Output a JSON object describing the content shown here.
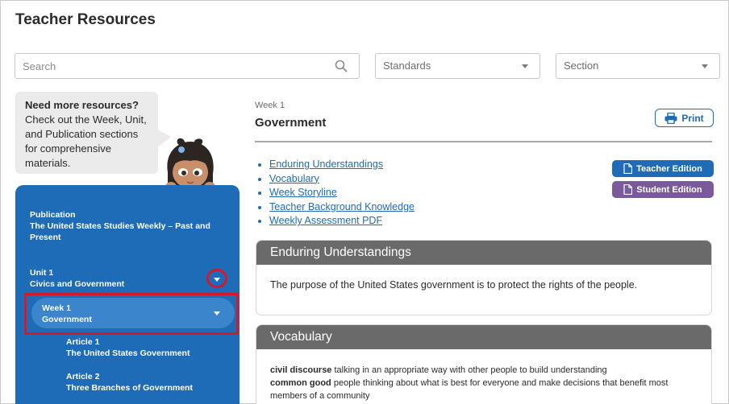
{
  "page": {
    "title": "Teacher Resources"
  },
  "filters": {
    "search_placeholder": "Search",
    "standards_label": "Standards",
    "section_label": "Section"
  },
  "bubble": {
    "bold": "Need more resources?",
    "text": "Check out the Week, Unit, and Publication sections for comprehensive materials."
  },
  "nav": {
    "publication": {
      "label": "Publication",
      "value": "The United States Studies Weekly – Past and Present"
    },
    "unit": {
      "label": "Unit 1",
      "value": "Civics and Government"
    },
    "week": {
      "label": "Week 1",
      "value": "Government"
    },
    "articles": [
      {
        "label": "Article 1",
        "value": "The United States Government"
      },
      {
        "label": "Article 2",
        "value": "Three Branches of Government"
      }
    ]
  },
  "content": {
    "week_label": "Week 1",
    "week_title": "Government",
    "print_label": "Print",
    "links": [
      "Enduring Understandings",
      "Vocabulary",
      "Week Storyline",
      "Teacher Background Knowledge",
      "Weekly Assessment PDF"
    ],
    "teacher_edition": "Teacher Edition",
    "student_edition": "Student Edition",
    "enduring": {
      "title": "Enduring Understandings",
      "text": "The purpose of the United States government is to protect the rights of the people."
    },
    "vocabulary": {
      "title": "Vocabulary",
      "terms": [
        {
          "term": "civil discourse",
          "definition": "talking in an appropriate way with other people to build understanding"
        },
        {
          "term": "common good",
          "definition": "people thinking about what is best for everyone and make decisions that benefit most members of a community"
        }
      ]
    }
  },
  "colors": {
    "primary_blue": "#1e6bb8",
    "student_purple": "#7b5a9c",
    "highlight_red": "#d11a2a",
    "card_header_gray": "#6a6a6a"
  }
}
